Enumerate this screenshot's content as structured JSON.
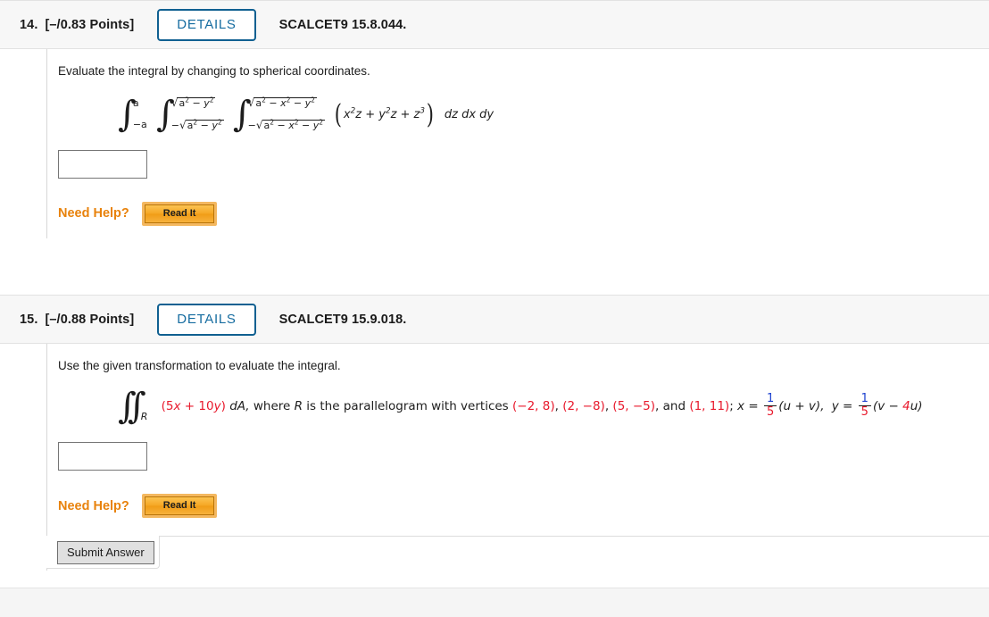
{
  "questions": [
    {
      "number": "14.",
      "points": "[–/0.83 Points]",
      "details_label": "DETAILS",
      "reference": "SCALCET9 15.8.044.",
      "prompt": "Evaluate the integral by changing to spherical coordinates.",
      "math": {
        "outer_upper": "a",
        "outer_lower": "−a",
        "mid_upper_sqrt": "a² − y²",
        "mid_lower_sqrt": "−√a² − y²",
        "inner_upper_sqrt": "a² − x² − y²",
        "inner_lower_sqrt": "−√a² − x² − y²",
        "integrand": "x²z + y²z + z³",
        "differentials": "dz dx dy"
      },
      "answer_value": "",
      "need_help_label": "Need Help?",
      "read_it_label": "Read It"
    },
    {
      "number": "15.",
      "points": "[–/0.88 Points]",
      "details_label": "DETAILS",
      "reference": "SCALCET9 15.9.018.",
      "prompt": "Use the given transformation to evaluate the integral.",
      "math": {
        "double_integral_subscript": "R",
        "integrand": "(5x + 10y)",
        "integrand_coeff_1": "5",
        "integrand_coeff_2": "10",
        "differential": "dA,",
        "description": "where R is the parallelogram with vertices",
        "vertices": [
          "(−2, 8)",
          "(2, −8)",
          "(5, −5)",
          "(1, 11)"
        ],
        "vertices_separator": ", ",
        "vertices_and": "and",
        "transform_semicolon": ";",
        "x_def_lhs": "x =",
        "x_frac_num": "1",
        "x_frac_den": "5",
        "x_def_rhs": "(u + v),",
        "y_def_lhs": "y =",
        "y_frac_num": "1",
        "y_frac_den": "5",
        "y_def_rhs_open": "(v − ",
        "y_def_rhs_coeff": "4",
        "y_def_rhs_close": "u)"
      },
      "answer_value": "",
      "need_help_label": "Need Help?",
      "read_it_label": "Read It"
    }
  ],
  "submit": {
    "label": "Submit Answer"
  },
  "colors": {
    "accent_blue": "#166ca0",
    "red": "#e8192c",
    "blue": "#1d42d0",
    "orange": "#e8820c",
    "header_bg": "#f7f7f7"
  }
}
